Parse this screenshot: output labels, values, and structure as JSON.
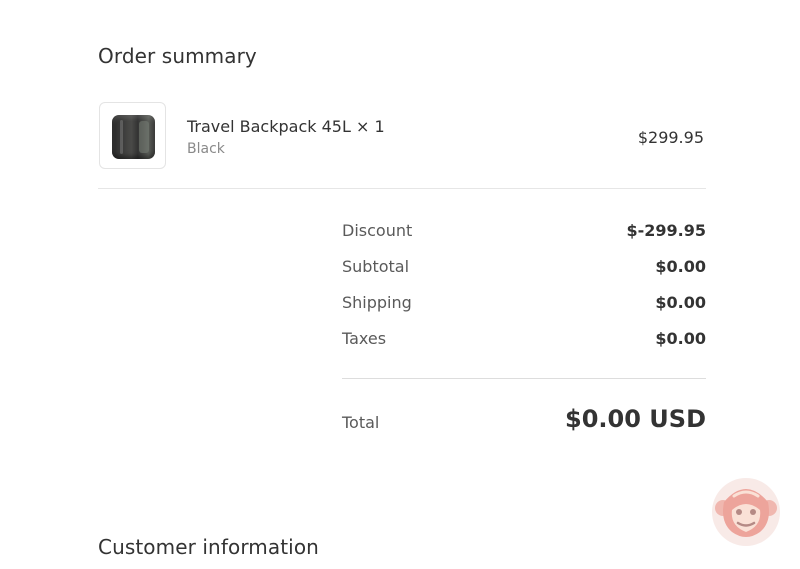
{
  "order_summary": {
    "title": "Order summary",
    "product": {
      "name": "Travel Backpack 45L × 1",
      "variant": "Black",
      "price": "$299.95",
      "thumbnail_icon": "backpack-image"
    },
    "lines": [
      {
        "label": "Discount",
        "value": "$-299.95"
      },
      {
        "label": "Subtotal",
        "value": "$0.00"
      },
      {
        "label": "Shipping",
        "value": "$0.00"
      },
      {
        "label": "Taxes",
        "value": "$0.00"
      }
    ],
    "total": {
      "label": "Total",
      "value": "$0.00 USD"
    }
  },
  "customer_information": {
    "title": "Customer information"
  },
  "watermark": {
    "icon": "monkey-logo-icon",
    "color": "#e05a4a"
  }
}
